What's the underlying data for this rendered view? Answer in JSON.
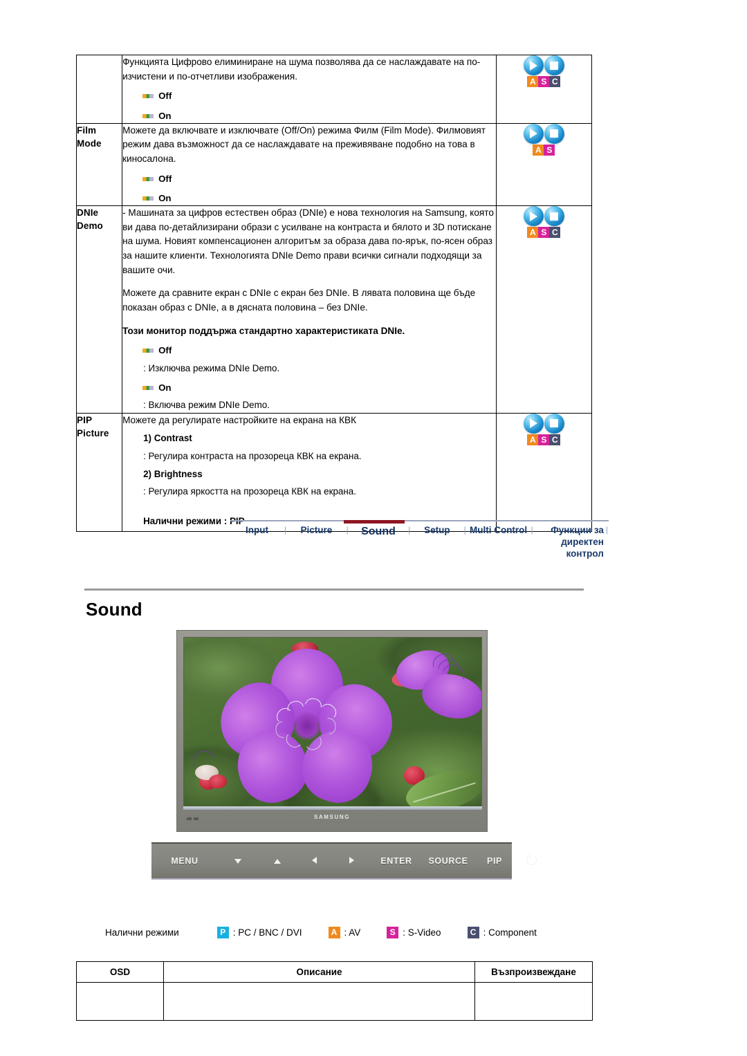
{
  "osd_table": {
    "rows": [
      {
        "label": "",
        "paragraphs": [
          "Функцията Цифрово елиминиране на шума позволява да се наслаждавате на по-изчистени и по-отчетливи изображения."
        ],
        "options": [
          "Off",
          "On"
        ],
        "icons": [
          "A",
          "S",
          "C"
        ]
      },
      {
        "label_lines": [
          "Film",
          "Mode"
        ],
        "paragraphs": [
          "Можете да включвате и изключвате (Off/On) режима Филм (Film Mode). Филмовият режим дава възможност да се наслаждавате на преживяване подобно на това в киносалона."
        ],
        "options": [
          "Off",
          "On"
        ],
        "icons": [
          "A",
          "S"
        ]
      },
      {
        "label_lines": [
          "DNIe",
          "Demo"
        ],
        "paragraphs": [
          "- Машината за цифров естествен образ (DNIe) е нова технология на Samsung, която ви дава по-детайлизирани образи с усилване на контраста и бялото и 3D потискане на шума. Новият компенсационен алгоритъм за образа дава по-ярък, по-ясен образ за нашите клиенти. Технологията DNIe Demo прави всички сигнали подходящи за вашите очи.",
          "Можете да сравните екран с DNIe с екран без DNIe. В лявата половина ще бъде показан образ с DNIe, а в дясната половина – без DNIe."
        ],
        "bold_note": "Този монитор поддържа стандартно характеристиката DNIe.",
        "option_blocks": [
          {
            "option": "Off",
            "desc": ": Изключва режима DNIe Demo."
          },
          {
            "option": "On",
            "desc": ": Включва режим DNIe Demo."
          }
        ],
        "icons": [
          "A",
          "S",
          "C"
        ]
      },
      {
        "label_lines": [
          "PIP",
          "Picture"
        ],
        "paragraphs": [
          "Можете да регулирате настройките на екрана на КВК"
        ],
        "numbered": [
          {
            "num": "1) Contrast",
            "desc": ": Регулира контраста на прозореца КВК на екрана."
          },
          {
            "num": "2) Brightness",
            "desc": ": Регулира яркостта на прозореца КВК на екрана."
          }
        ],
        "available": "Налични режими : PIP",
        "icons": [
          "A",
          "S",
          "C"
        ]
      }
    ]
  },
  "nav": {
    "items": [
      {
        "label": "Input",
        "active": false
      },
      {
        "label": "Picture",
        "active": false
      },
      {
        "label": "Sound",
        "active": true
      },
      {
        "label": "Setup",
        "active": false
      },
      {
        "label": "Multi Control",
        "active": false
      },
      {
        "label": "Функции за директен контрол",
        "active": false
      }
    ],
    "separator": "|",
    "active_color": "#8e1622",
    "text_color": "#1a3a6b"
  },
  "page": {
    "title": "Sound"
  },
  "monitor": {
    "brand": "SAMSUNG",
    "controls": [
      {
        "label": "MENU",
        "type": "text"
      },
      {
        "label": "▼",
        "type": "down"
      },
      {
        "label": "▲",
        "type": "up"
      },
      {
        "label": "◄",
        "type": "left"
      },
      {
        "label": "►",
        "type": "right"
      },
      {
        "label": "ENTER",
        "type": "text"
      },
      {
        "label": "SOURCE",
        "type": "text"
      },
      {
        "label": "PIP",
        "type": "text"
      },
      {
        "label": "power",
        "type": "power"
      }
    ]
  },
  "legend": {
    "label": "Налични режими",
    "items": [
      {
        "key": "P",
        "text": ": PC / BNC / DVI",
        "color": "#19b0e0"
      },
      {
        "key": "A",
        "text": ": AV",
        "color": "#f08a1e"
      },
      {
        "key": "S",
        "text": ": S-Video",
        "color": "#d6229a"
      },
      {
        "key": "C",
        "text": ": Component",
        "color": "#4a4f6e"
      }
    ]
  },
  "bottom_table": {
    "headers": [
      "OSD",
      "Описание",
      "Възпроизвеждане"
    ]
  }
}
